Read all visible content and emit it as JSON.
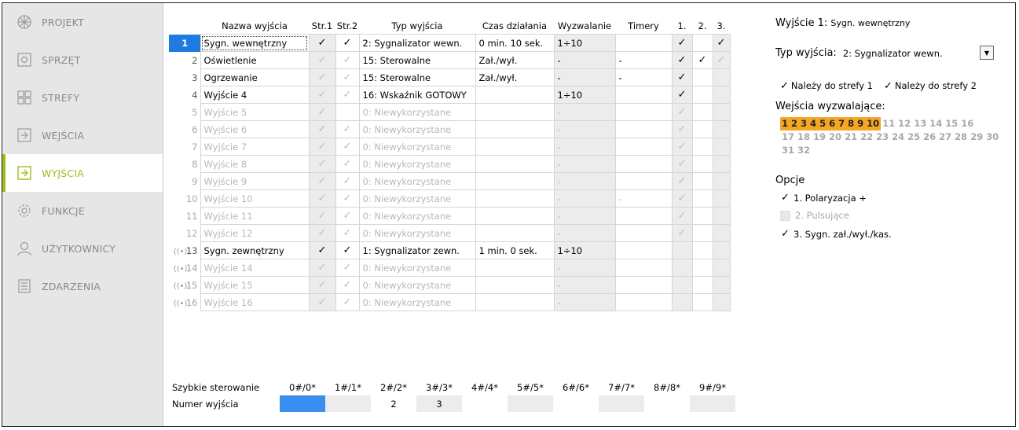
{
  "sidebar": {
    "items": [
      {
        "label": "PROJEKT",
        "icon": "project-icon"
      },
      {
        "label": "SPRZĘT",
        "icon": "hardware-icon"
      },
      {
        "label": "STREFY",
        "icon": "zones-icon"
      },
      {
        "label": "WEJŚCIA",
        "icon": "inputs-icon"
      },
      {
        "label": "WYJŚCIA",
        "icon": "outputs-icon"
      },
      {
        "label": "FUNKCJE",
        "icon": "gear-icon"
      },
      {
        "label": "UŻYTKOWNICY",
        "icon": "user-icon"
      },
      {
        "label": "ZDARZENIA",
        "icon": "events-icon"
      }
    ],
    "active_index": 4,
    "active_color": "#9bbf1a"
  },
  "table": {
    "headers": [
      "Nazwa wyjścia",
      "Str.1",
      "Str.2",
      "Typ wyjścia",
      "Czas działania",
      "Wyzwalanie",
      "Timery",
      "1.",
      "2.",
      "3."
    ],
    "rows": [
      {
        "num": "1",
        "name": "Sygn. wewnętrzny",
        "s1": "on",
        "s2": "on",
        "type": "2: Sygnalizator wewn.",
        "time": "0 min. 10 sek.",
        "trig": "1÷10",
        "timers": "",
        "c1": "on",
        "c2": "",
        "c3": "on",
        "enabled": true,
        "wireless": false
      },
      {
        "num": "2",
        "name": "Oświetlenie",
        "s1": "off",
        "s2": "off",
        "type": "15: Sterowalne",
        "time": "Zał./wył.",
        "trig": "-",
        "timers": "-",
        "c1": "on",
        "c2": "on",
        "c3": "off",
        "enabled": true,
        "wireless": false
      },
      {
        "num": "3",
        "name": "Ogrzewanie",
        "s1": "off",
        "s2": "off",
        "type": "15: Sterowalne",
        "time": "Zał./wył.",
        "trig": "-",
        "timers": "-",
        "c1": "on",
        "c2": "",
        "c3": "",
        "enabled": true,
        "wireless": false
      },
      {
        "num": "4",
        "name": "Wyjście  4",
        "s1": "off",
        "s2": "off",
        "type": "16: Wskaźnik GOTOWY",
        "time": "",
        "trig": "1÷10",
        "timers": "",
        "c1": "on",
        "c2": "",
        "c3": "",
        "enabled": true,
        "wireless": false
      },
      {
        "num": "5",
        "name": "Wyjście  5",
        "s1": "off",
        "s2": "",
        "type": "0: Niewykorzystane",
        "time": "",
        "trig": "-",
        "timers": "",
        "c1": "off",
        "c2": "",
        "c3": "",
        "enabled": false,
        "wireless": false
      },
      {
        "num": "6",
        "name": "Wyjście  6",
        "s1": "off",
        "s2": "off",
        "type": "0: Niewykorzystane",
        "time": "",
        "trig": "-",
        "timers": "",
        "c1": "off",
        "c2": "",
        "c3": "",
        "enabled": false,
        "wireless": false
      },
      {
        "num": "7",
        "name": "Wyjście  7",
        "s1": "off",
        "s2": "off",
        "type": "0: Niewykorzystane",
        "time": "",
        "trig": "-",
        "timers": "",
        "c1": "off",
        "c2": "",
        "c3": "",
        "enabled": false,
        "wireless": false
      },
      {
        "num": "8",
        "name": "Wyjście  8",
        "s1": "off",
        "s2": "off",
        "type": "0: Niewykorzystane",
        "time": "",
        "trig": "-",
        "timers": "",
        "c1": "off",
        "c2": "",
        "c3": "",
        "enabled": false,
        "wireless": false
      },
      {
        "num": "9",
        "name": "Wyjście  9",
        "s1": "off",
        "s2": "off",
        "type": "0: Niewykorzystane",
        "time": "",
        "trig": "-",
        "timers": "",
        "c1": "off",
        "c2": "",
        "c3": "",
        "enabled": false,
        "wireless": false
      },
      {
        "num": "10",
        "name": "Wyjście  10",
        "s1": "off",
        "s2": "off",
        "type": "0: Niewykorzystane",
        "time": "",
        "trig": "-",
        "timers": "-",
        "c1": "off",
        "c2": "",
        "c3": "",
        "enabled": false,
        "wireless": false
      },
      {
        "num": "11",
        "name": "Wyjście  11",
        "s1": "off",
        "s2": "off",
        "type": "0: Niewykorzystane",
        "time": "",
        "trig": "-",
        "timers": "",
        "c1": "off",
        "c2": "",
        "c3": "",
        "enabled": false,
        "wireless": false
      },
      {
        "num": "12",
        "name": "Wyjście  12",
        "s1": "off",
        "s2": "off",
        "type": "0: Niewykorzystane",
        "time": "",
        "trig": "-",
        "timers": "",
        "c1": "off",
        "c2": "",
        "c3": "",
        "enabled": false,
        "wireless": false
      },
      {
        "num": "13",
        "name": "Sygn. zewnętrzny",
        "s1": "on",
        "s2": "on",
        "type": "1: Sygnalizator zewn.",
        "time": "1 min. 0 sek.",
        "trig": "1÷10",
        "timers": "",
        "c1": "",
        "c2": "",
        "c3": "",
        "enabled": true,
        "wireless": true
      },
      {
        "num": "14",
        "name": "Wyjście  14",
        "s1": "off",
        "s2": "off",
        "type": "0: Niewykorzystane",
        "time": "",
        "trig": "-",
        "timers": "",
        "c1": "",
        "c2": "",
        "c3": "",
        "enabled": false,
        "wireless": true
      },
      {
        "num": "15",
        "name": "Wyjście  15",
        "s1": "off",
        "s2": "off",
        "type": "0: Niewykorzystane",
        "time": "",
        "trig": "-",
        "timers": "",
        "c1": "",
        "c2": "",
        "c3": "",
        "enabled": false,
        "wireless": true
      },
      {
        "num": "16",
        "name": "Wyjście  16",
        "s1": "off",
        "s2": "off",
        "type": "0: Niewykorzystane",
        "time": "",
        "trig": "-",
        "timers": "",
        "c1": "",
        "c2": "",
        "c3": "",
        "enabled": false,
        "wireless": true
      }
    ],
    "selected_row": 0,
    "selected_color": "#1e7be0"
  },
  "quick_control": {
    "label": "Szybkie sterowanie",
    "codes": [
      "0#/0*",
      "1#/1*",
      "2#/2*",
      "3#/3*",
      "4#/4*",
      "5#/5*",
      "6#/6*",
      "7#/7*",
      "8#/8*",
      "9#/9*"
    ],
    "row_label": "Numer wyjścia",
    "values": [
      "",
      "",
      "2",
      "3",
      "",
      "",
      "",
      "",
      "",
      ""
    ]
  },
  "panel": {
    "title": "Wyjście 1:",
    "subtitle": "Sygn. wewnętrzny",
    "type_label": "Typ wyjścia:",
    "type_value": "2: Sygnalizator wewn.",
    "zone1_label": "Należy do strefy 1",
    "zone2_label": "Należy do strefy 2",
    "trigger_label": "Wejścia wyzwalające:",
    "triggers_row1": [
      "1",
      "2",
      "3",
      "4",
      "5",
      "6",
      "7",
      "8",
      "9",
      "10",
      "11",
      "12",
      "13",
      "14",
      "15",
      "16"
    ],
    "triggers_row2": [
      "17",
      "18",
      "19",
      "20",
      "21",
      "22",
      "23",
      "24",
      "25",
      "26",
      "27",
      "28",
      "29",
      "30",
      "31",
      "32"
    ],
    "triggers_active": [
      "1",
      "2",
      "3",
      "4",
      "5",
      "6",
      "7",
      "8",
      "9",
      "10"
    ],
    "trigger_active_color": "#f5a623",
    "options_label": "Opcje",
    "options": [
      {
        "label": "1. Polaryzacja +",
        "checked": true,
        "enabled": true
      },
      {
        "label": "2. Pulsujące",
        "checked": false,
        "enabled": false
      },
      {
        "label": "3. Sygn. zał./wył./kas.",
        "checked": true,
        "enabled": true
      }
    ]
  }
}
